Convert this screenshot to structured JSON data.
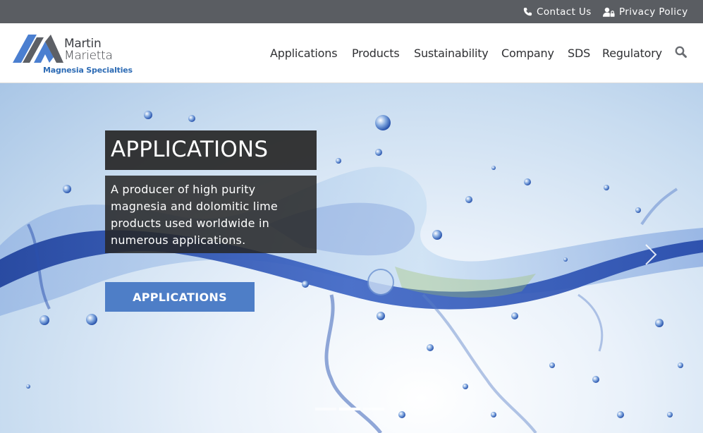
{
  "topbar": {
    "contact_label": "Contact Us",
    "privacy_label": "Privacy Policy"
  },
  "logo": {
    "line1": "Martin",
    "line2": "Marietta",
    "tagline": "Magnesia Specialties"
  },
  "nav": {
    "items": [
      "Applications",
      "Products",
      "Sustainability",
      "Company",
      "SDS",
      "Regulatory"
    ],
    "search_icon": "search-icon"
  },
  "hero": {
    "title": "APPLICATIONS",
    "description": "A producer of high purity magnesia and dolomitic lime products used worldwide in numerous applications.",
    "button_label": "APPLICATIONS",
    "slide_count": 3,
    "active_slide": 2
  },
  "colors": {
    "topbar": "#5a5d62",
    "brand_blue": "#2e6cb5",
    "button": "#4e7ec7",
    "logo_dark": "#3d3f44"
  }
}
